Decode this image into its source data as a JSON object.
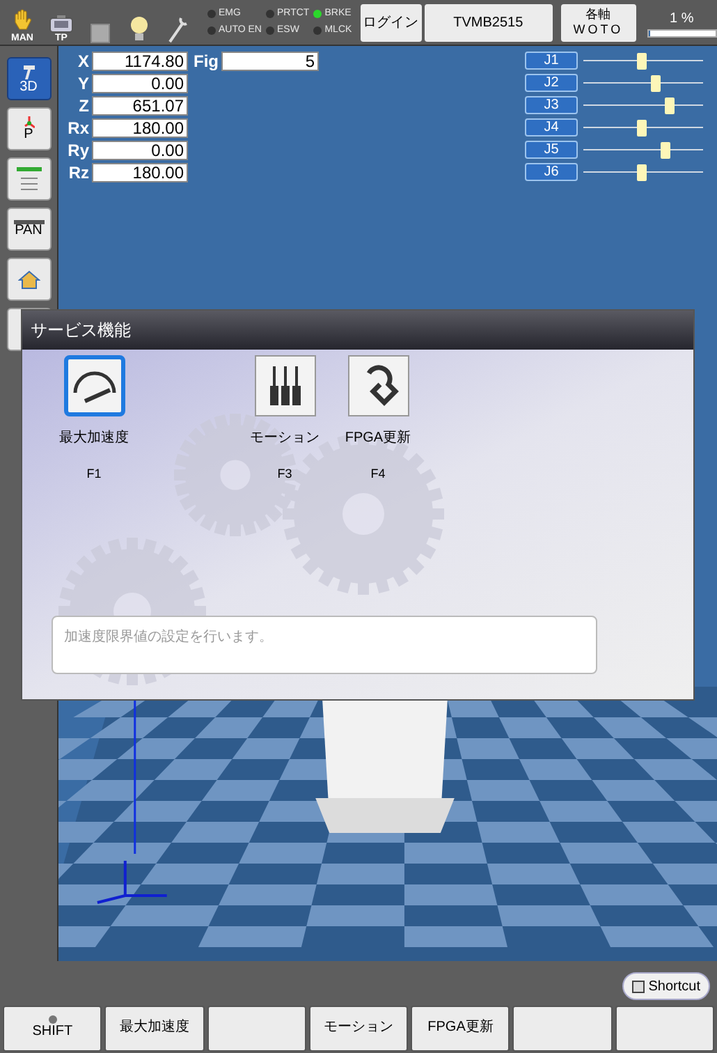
{
  "status_bar": {
    "mode_icons": [
      {
        "kind": "hand",
        "label": "MAN"
      },
      {
        "kind": "pendant",
        "label": "TP"
      },
      {
        "kind": "square"
      },
      {
        "kind": "bulb"
      },
      {
        "kind": "wrench"
      }
    ],
    "indicators": [
      {
        "label": "EMG",
        "on": false
      },
      {
        "label": "AUTO EN",
        "on": false
      },
      {
        "label": "PRTCT",
        "on": false
      },
      {
        "label": "ESW",
        "on": false
      },
      {
        "label": "BRKE",
        "on": true
      },
      {
        "label": "MLCK",
        "on": false
      }
    ],
    "login_button": "ログイン",
    "model_button": "TVMB2515",
    "axis_button": {
      "top": "各軸",
      "bottom": "WOTO"
    },
    "speed": {
      "reading": "1 %",
      "level": 0.02
    }
  },
  "tools": [
    {
      "kind": "threed",
      "label": "3D",
      "selected": true
    },
    {
      "kind": "p",
      "label": "P",
      "selected": false
    },
    {
      "kind": "list",
      "selected": false
    },
    {
      "kind": "pan",
      "label": "PAN",
      "selected": false
    },
    {
      "kind": "home",
      "selected": false
    },
    {
      "kind": "hidden",
      "selected": false
    }
  ],
  "coordinates": [
    {
      "label": "X",
      "value": "1174.80"
    },
    {
      "label": "Y",
      "value": "0.00"
    },
    {
      "label": "Z",
      "value": "651.07"
    },
    {
      "label": "Rx",
      "value": "180.00"
    },
    {
      "label": "Ry",
      "value": "0.00"
    },
    {
      "label": "Rz",
      "value": "180.00"
    }
  ],
  "fig": {
    "label": "Fig",
    "value": "5"
  },
  "joints": [
    {
      "label": "J1",
      "level": 0.49
    },
    {
      "label": "J2",
      "level": 0.6
    },
    {
      "label": "J3",
      "level": 0.72
    },
    {
      "label": "J4",
      "level": 0.49
    },
    {
      "label": "J5",
      "level": 0.69
    },
    {
      "label": "J6",
      "level": 0.49
    }
  ],
  "dialog": {
    "title": "サービス機能",
    "items": [
      {
        "kind": "gauge",
        "label": "最大加速度",
        "key": "F1",
        "selected": true
      },
      {
        "kind": "motion",
        "label": "モーション",
        "key": "F3",
        "selected": false
      },
      {
        "kind": "fpga",
        "label": "FPGA更新",
        "key": "F4",
        "selected": false
      }
    ],
    "description": "加速度限界値の設定を行います。"
  },
  "shortcut_button": "Shortcut",
  "function_keys": [
    {
      "kind": "shift",
      "label": "SHIFT"
    },
    {
      "kind": "key",
      "label": "最大加速度"
    },
    {
      "kind": "blank"
    },
    {
      "kind": "key",
      "label": "モーション"
    },
    {
      "kind": "key",
      "label": "FPGA更新"
    },
    {
      "kind": "blank"
    },
    {
      "kind": "blank"
    }
  ]
}
